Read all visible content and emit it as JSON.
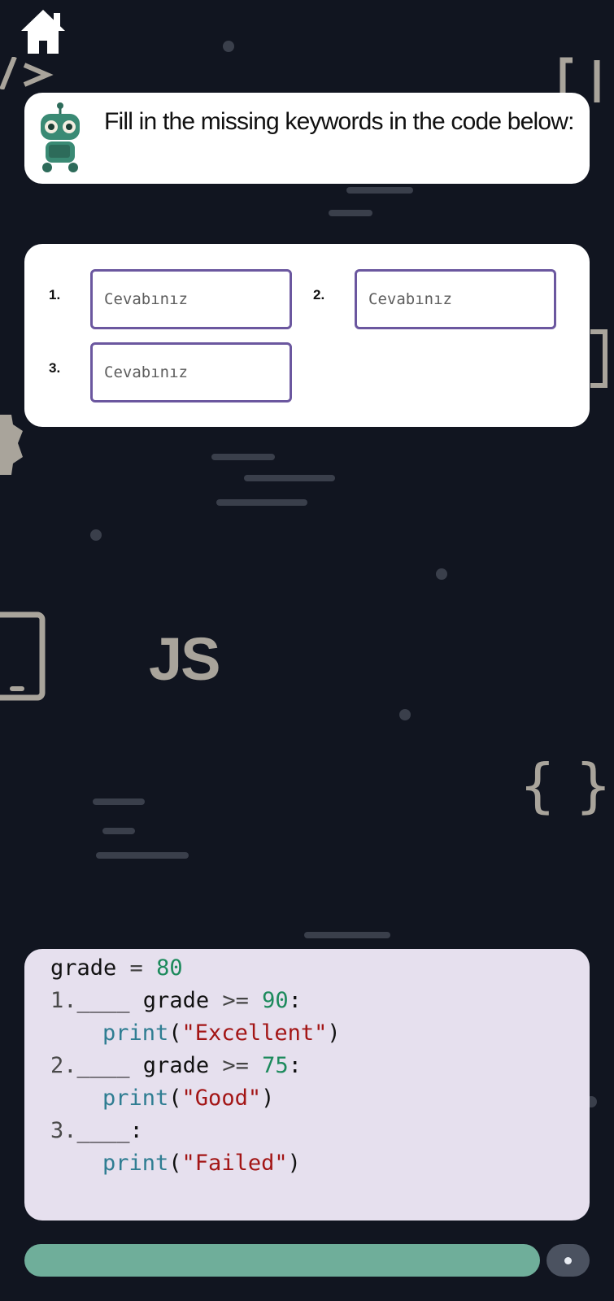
{
  "instruction": "Fill in the missing keywords in the code below:",
  "answers": [
    {
      "number": "1.",
      "placeholder": "Cevabınız"
    },
    {
      "number": "2.",
      "placeholder": "Cevabınız"
    },
    {
      "number": "3.",
      "placeholder": "Cevabınız"
    }
  ],
  "background": {
    "js_label": "JS",
    "braces": "{ }"
  },
  "code": {
    "line1": {
      "a": "grade ",
      "b": "= ",
      "c": "80"
    },
    "line2": {
      "a": "1.",
      "b": "____",
      "c": " grade ",
      "d": ">= ",
      "e": "90",
      "f": ":"
    },
    "line3": {
      "a": "print",
      "b": "(",
      "c": "\"Excellent\"",
      "d": ")"
    },
    "line4": {
      "a": "2.",
      "b": "____",
      "c": " grade ",
      "d": ">= ",
      "e": "75",
      "f": ":"
    },
    "line5": {
      "a": "print",
      "b": "(",
      "c": "\"Good\"",
      "d": ")"
    },
    "line6": {
      "a": "3.",
      "b": "____",
      "c": ":"
    },
    "line7": {
      "a": "print",
      "b": "(",
      "c": "\"Failed\"",
      "d": ")"
    }
  },
  "colors": {
    "accent": "#6b579f",
    "progress": "#6fae9a",
    "code_bg": "#e6e0ee",
    "background": "#111520"
  },
  "progress": 1.0
}
